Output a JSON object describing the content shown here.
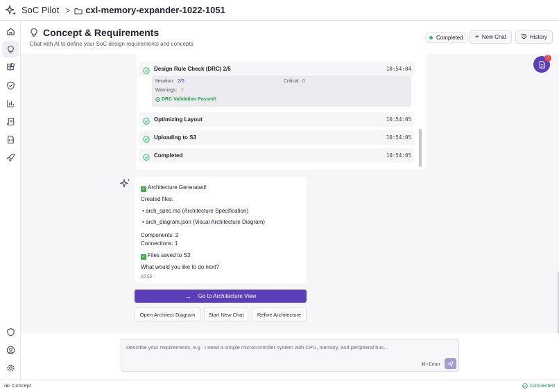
{
  "app": {
    "name": "SoC Pilot",
    "separator": ">",
    "project": "cxl-memory-expander-1022-1051"
  },
  "header": {
    "title": "Concept & Requirements",
    "subtitle": "Chat with AI to define your SoC design requirements and concepts",
    "status_badge": "Completed",
    "new_chat_label": "New Chat",
    "history_label": "History"
  },
  "notifications": {
    "count": "7"
  },
  "steps": [
    {
      "label": "Design Rule Check (DRC) 2/5",
      "time": "10:54:04"
    },
    {
      "label": "Optimizing Layout",
      "time": "10:54:05"
    },
    {
      "label": "Uploading to S3",
      "time": "10:54:05"
    },
    {
      "label": "Completed",
      "time": "10:54:05"
    }
  ],
  "drc": {
    "iteration_label": "Iteration:",
    "iteration_value": "2/5",
    "critical_label": "Critical:",
    "critical_value": "0",
    "warnings_label": "Warnings:",
    "warnings_value": "2",
    "passed": "DRC Validation Passed!"
  },
  "message": {
    "line1": "Architecture Generated!",
    "created": "Created files:",
    "file1": "• arch_spec.md (Architecture Specification)",
    "file2": "• arch_diagram.json (Visual Architecture Diagram)",
    "components": "Components: 2",
    "connections": "Connections: 1",
    "saved": "Files saved to S3",
    "question": "What would you like to do next?",
    "time": "10:55"
  },
  "actions": {
    "primary": "Go to Architecture View",
    "open_diagram": "Open Architect Diagram",
    "new_chat": "Start New Chat",
    "refine": "Refine Architecture"
  },
  "input": {
    "placeholder": "Describe your requirements, e.g.: I need a simple microcontroller system with CPU, memory, and peripheral bus...",
    "shortcut": "⌘+Enter"
  },
  "statusbar": {
    "mode": "Concept",
    "connection": "Connected"
  },
  "colors": {
    "accent": "#5b3fb8",
    "success": "#22c55e",
    "warning": "#e59a0b",
    "danger": "#e5484d"
  }
}
